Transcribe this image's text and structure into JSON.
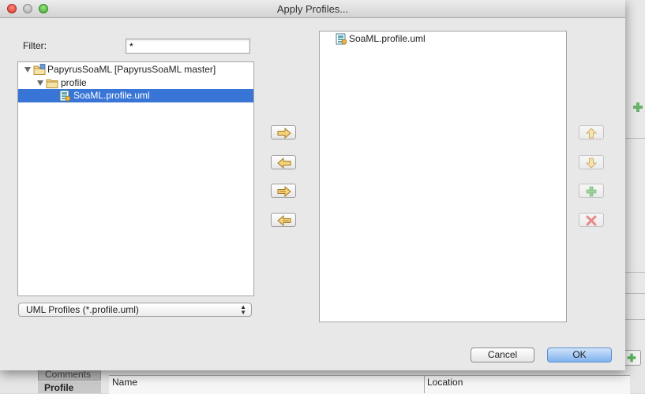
{
  "dialog": {
    "title": "Apply Profiles..."
  },
  "filter": {
    "label": "Filter:",
    "value": "*"
  },
  "tree": {
    "items": [
      {
        "label": "PapyrusSoaML  [PapyrusSoaML master]",
        "icon": "project-folder-icon",
        "expanded": true
      },
      {
        "label": "profile",
        "icon": "folder-icon",
        "expanded": true
      },
      {
        "label": "SoaML.profile.uml",
        "icon": "uml-profile-icon",
        "selected": true
      }
    ]
  },
  "file_type": {
    "selected": "UML Profiles (*.profile.uml)"
  },
  "transfer_buttons": [
    "add-arrow-icon",
    "remove-arrow-icon",
    "add-all-arrow-icon",
    "remove-all-arrow-icon"
  ],
  "order_buttons": [
    "up-arrow-icon",
    "down-arrow-icon",
    "plus-icon",
    "delete-x-icon"
  ],
  "applied_profiles": {
    "items": [
      {
        "label": "SoaML.profile.uml",
        "icon": "uml-profile-icon"
      }
    ]
  },
  "buttons": {
    "cancel": "Cancel",
    "ok": "OK"
  },
  "background": {
    "tab_comments": "Comments",
    "tab_profile": "Profile",
    "col_name": "Name",
    "col_location": "Location"
  },
  "colors": {
    "selection": "#3875d7",
    "accent_arrow": "#e8b64a",
    "plus_green": "#5cb85c",
    "delete_red": "#d9534f"
  }
}
